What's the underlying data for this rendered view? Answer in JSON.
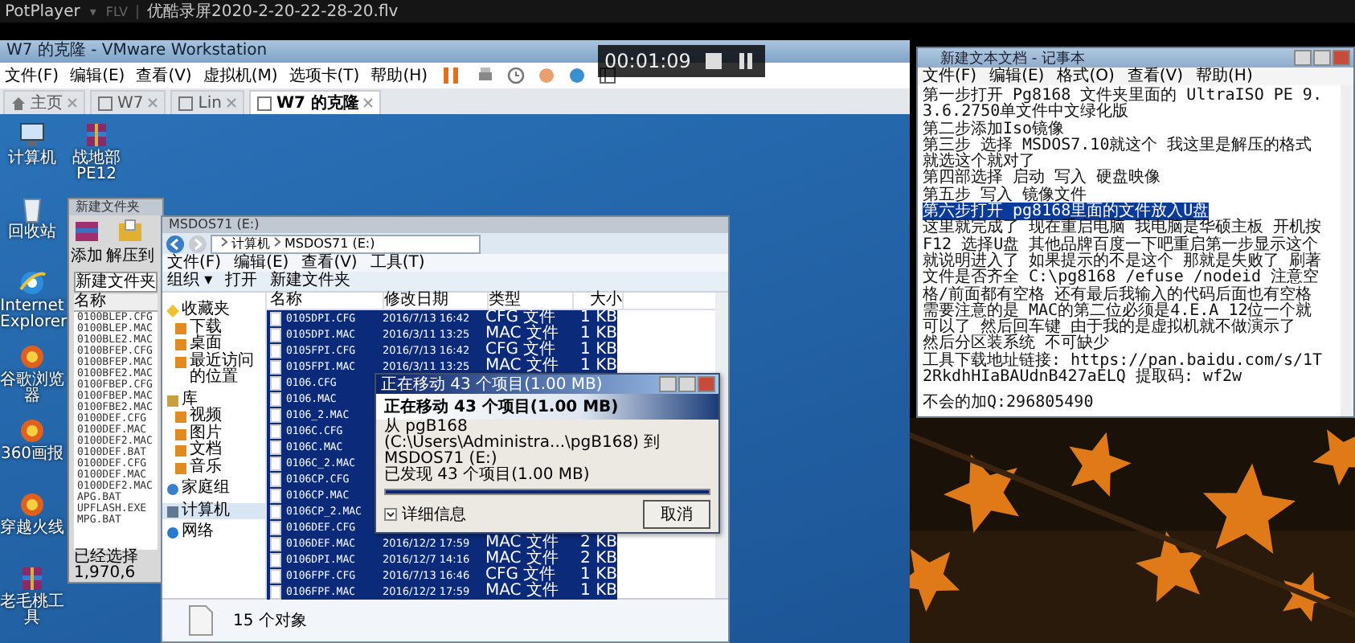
{
  "player": {
    "app": "PotPlayer",
    "menu_caret": "▾",
    "format": "FLV",
    "filename": "优酷录屏2020-2-20-22-28-20.flv"
  },
  "osd": {
    "time": "00:01:09"
  },
  "vmware": {
    "title": "W7 的克隆 - VMware Workstation",
    "menu": [
      "文件(F)",
      "编辑(E)",
      "查看(V)",
      "虚拟机(M)",
      "选项卡(T)",
      "帮助(H)"
    ],
    "tabs": [
      {
        "label": "主页",
        "kind": "home",
        "selected": false
      },
      {
        "label": "W7",
        "kind": "vm",
        "selected": false
      },
      {
        "label": "Lin",
        "kind": "vm",
        "selected": false
      },
      {
        "label": "W7 的克隆",
        "kind": "vm",
        "selected": true
      }
    ],
    "desktop_icons": [
      {
        "label": "计算机",
        "kind": "computer"
      },
      {
        "label": "回收站",
        "kind": "recycle"
      },
      {
        "label": "Internet Explorer",
        "kind": "browser"
      },
      {
        "label": "谷歌浏览器",
        "kind": "app"
      },
      {
        "label": "360画报",
        "kind": "app"
      },
      {
        "label": "穿越火线",
        "kind": "app"
      },
      {
        "label": "老毛桃工具",
        "kind": "archive"
      },
      {
        "label": "战地部PE12",
        "kind": "archive"
      }
    ]
  },
  "winrar": {
    "title": "新建文件夹",
    "toolbar": [
      "添加",
      "解压到"
    ],
    "path": "新建文件夹",
    "column": "名称",
    "files": [
      "0100BLEP.CFG",
      "0100BLEP.MAC",
      "0100BLE2.MAC",
      "0100BFEP.CFG",
      "0100BFEP.MAC",
      "0100BFE2.MAC",
      "0100FBEP.CFG",
      "0100FBEP.MAC",
      "0100FBE2.MAC",
      "0100DEF.CFG",
      "0100DEF.MAC",
      "0100DEF2.MAC",
      "0100DEF.BAT",
      "0100DEF.CFG",
      "0100DEF.MAC",
      "0100DEF2.MAC",
      "APG.BAT",
      "UPFLASH.EXE",
      "MPG.BAT"
    ],
    "status": "已经选择 1,970,6"
  },
  "explorer": {
    "title": "MSDOS71 (E:)",
    "breadcrumb": [
      "计算机",
      "MSDOS71 (E:)"
    ],
    "menu": [
      "文件(F)",
      "编辑(E)",
      "查看(V)",
      "工具(T)"
    ],
    "toolbar": [
      "组织 ▾",
      "打开",
      "新建文件夹"
    ],
    "nav": [
      {
        "label": "收藏夹",
        "kind": "star",
        "children": [
          {
            "label": "下载",
            "kind": "folder"
          },
          {
            "label": "桌面",
            "kind": "folder"
          },
          {
            "label": "最近访问的位置",
            "kind": "folder"
          }
        ]
      },
      {
        "label": "库",
        "kind": "library",
        "children": [
          {
            "label": "视频",
            "kind": "folder"
          },
          {
            "label": "图片",
            "kind": "folder"
          },
          {
            "label": "文档",
            "kind": "folder"
          },
          {
            "label": "音乐",
            "kind": "folder"
          }
        ]
      },
      {
        "label": "家庭组",
        "kind": "group"
      },
      {
        "label": "计算机",
        "kind": "computer",
        "selected": true
      },
      {
        "label": "网络",
        "kind": "network"
      }
    ],
    "columns": [
      "名称",
      "修改日期",
      "类型",
      "大小"
    ],
    "rows": [
      {
        "name": "0105DPI.CFG",
        "date": "2016/7/13 16:42",
        "type": "CFG 文件",
        "size": "1 KB",
        "selected": true
      },
      {
        "name": "0105DPI.MAC",
        "date": "2016/3/11 13:25",
        "type": "MAC 文件",
        "size": "1 KB",
        "selected": true
      },
      {
        "name": "0105FPI.CFG",
        "date": "2016/7/13 16:42",
        "type": "CFG 文件",
        "size": "1 KB",
        "selected": true
      },
      {
        "name": "0105FPI.MAC",
        "date": "2016/3/11 13:25",
        "type": "MAC 文件",
        "size": "1 KB",
        "selected": true
      },
      {
        "name": "0106.CFG",
        "selected": true
      },
      {
        "name": "0106.MAC",
        "selected": true
      },
      {
        "name": "0106_2.MAC",
        "selected": true
      },
      {
        "name": "0106C.CFG",
        "selected": true
      },
      {
        "name": "0106C.MAC",
        "selected": true
      },
      {
        "name": "0106C_2.MAC",
        "selected": true
      },
      {
        "name": "0106CP.CFG",
        "selected": true
      },
      {
        "name": "0106CP.MAC",
        "selected": true
      },
      {
        "name": "0106CP_2.MAC",
        "selected": true
      },
      {
        "name": "0106DEF.CFG",
        "selected": true
      },
      {
        "name": "0106DEF.MAC",
        "date": "2016/12/2 17:59",
        "type": "MAC 文件",
        "size": "2 KB",
        "selected": true
      },
      {
        "name": "0106DPI.MAC",
        "date": "2016/12/7 14:16",
        "type": "MAC 文件",
        "size": "2 KB",
        "selected": true
      },
      {
        "name": "0106FPF.CFG",
        "date": "2016/7/13 16:46",
        "type": "CFG 文件",
        "size": "1 KB",
        "selected": true
      },
      {
        "name": "0106FPF.MAC",
        "date": "2016/12/2 17:59",
        "type": "MAC 文件",
        "size": "1 KB",
        "selected": true
      }
    ],
    "status": "15 个对象"
  },
  "dialog": {
    "title": "正在移动 43 个项目(1.00 MB)",
    "heading": "正在移动 43 个项目(1.00 MB)",
    "from": "从 pgB168 (C:\\Users\\Administra...\\pgB168) 到 MSDOS71 (E:)",
    "found": "已发现 43 个项目(1.00 MB)",
    "level": 1,
    "details": "详细信息",
    "cancel": "取消"
  },
  "notepad": {
    "title": "新建文本文档 - 记事本",
    "menu": [
      "文件(F)",
      "编辑(E)",
      "格式(O)",
      "查看(V)",
      "帮助(H)"
    ],
    "lines": [
      {
        "text": "第一步打开 Pg8168 文件夹里面的 UltraISO PE 9.3.6.2750单文件中文绿化版",
        "selected": false
      },
      {
        "text": "第二步添加Iso镜像",
        "selected": false
      },
      {
        "text": "第三步 选择 MSDOS7.10就这个 我这里是解压的格式就选这个就对了",
        "selected": false
      },
      {
        "text": "第四部选择 启动 写入 硬盘映像",
        "selected": false
      },
      {
        "text": "第五步 写入 镜像文件",
        "selected": false
      },
      {
        "text": "第六步打开 pg8168里面的文件放入U盘",
        "selected": true
      },
      {
        "text": "这里就完成了 现在重启电脑 我电脑是华硕主板 开机按F12 选择U盘 其他品牌百度一下吧重启第一步显示这个就说明进入了 如果提示的不是这个 那就是失败了 刷著文件是否齐全 C:\\pg8168 /efuse /nodeid 注意空格/前面都有空格 还有最后我输入的代码后面也有空格需要注意的是 MAC的第二位必须是4.E.A 12位一个就可以了 然后回车键 由于我的是虚拟机就不做演示了",
        "selected": false
      },
      {
        "text": "然后分区装系统 不可缺少",
        "selected": false
      },
      {
        "text": "工具下载地址链接: https://pan.baidu.com/s/1T2RkdhHIaBAUdnB427aELQ 提取码: wf2w",
        "selected": false
      }
    ],
    "footer_line": "不会的加Q:296805490"
  }
}
